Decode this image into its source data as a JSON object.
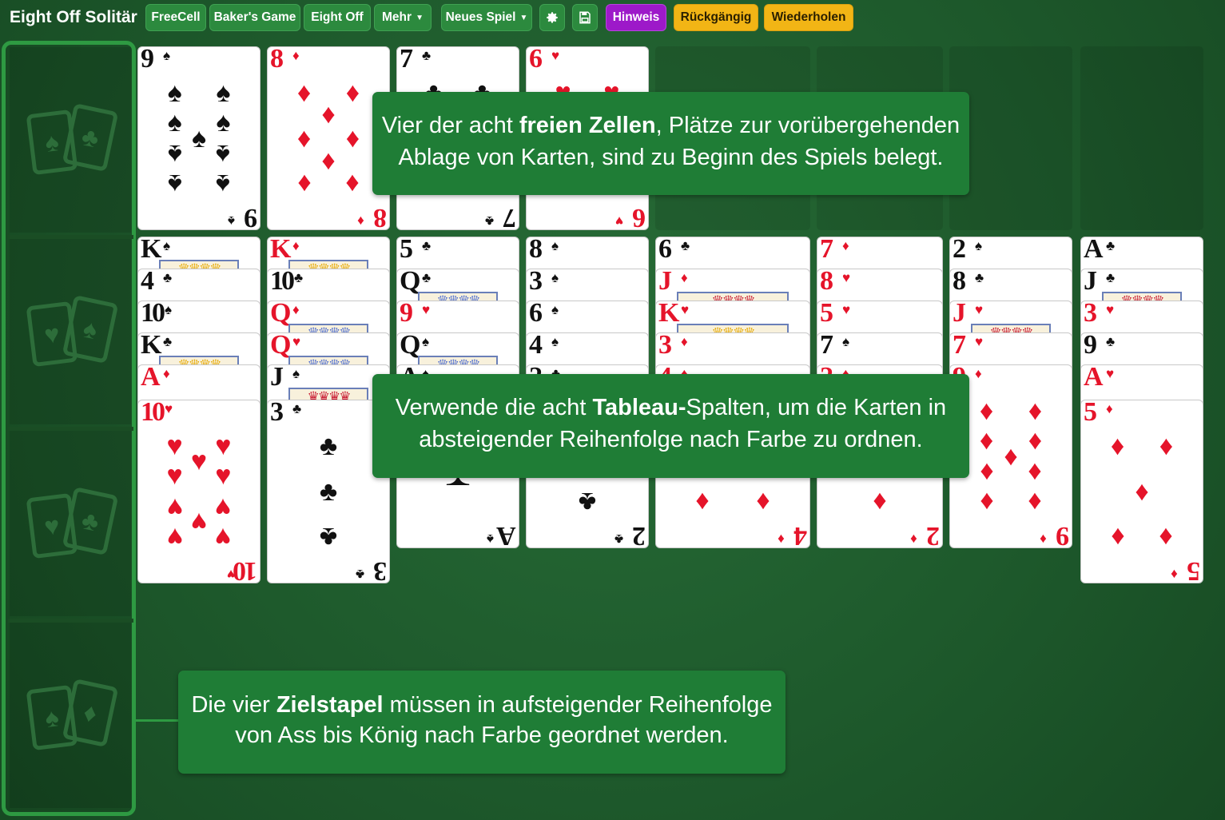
{
  "app": {
    "title": "Eight Off Solitär"
  },
  "toolbar": {
    "freecell": "FreeCell",
    "bakers_game": "Baker's Game",
    "eight_off": "Eight Off",
    "more": "Mehr",
    "new_game": "Neues Spiel",
    "hint": "Hinweis",
    "undo": "Rückgängig",
    "redo": "Wiederholen"
  },
  "icons": {
    "settings": "gear-icon",
    "save": "floppy-disk-icon",
    "dropdown": "chevron-down-icon"
  },
  "colors": {
    "felt": "#1e5a2c",
    "toolbar_green": "#2c8a3e",
    "hint_purple": "#9d19c9",
    "undo_yellow": "#f2b515",
    "red_suit": "#e5142a"
  },
  "free_cells": [
    {
      "rank": "9",
      "suit": "♠"
    },
    {
      "rank": "8",
      "suit": "♦"
    },
    {
      "rank": "7",
      "suit": "♣"
    },
    {
      "rank": "6",
      "suit": "♥"
    },
    null,
    null,
    null,
    null
  ],
  "tableau": [
    [
      {
        "rank": "K",
        "suit": "♠"
      },
      {
        "rank": "4",
        "suit": "♣"
      },
      {
        "rank": "10",
        "suit": "♠"
      },
      {
        "rank": "K",
        "suit": "♣"
      },
      {
        "rank": "A",
        "suit": "♦"
      },
      {
        "rank": "10",
        "suit": "♥"
      }
    ],
    [
      {
        "rank": "K",
        "suit": "♦"
      },
      {
        "rank": "10",
        "suit": "♣"
      },
      {
        "rank": "Q",
        "suit": "♦"
      },
      {
        "rank": "Q",
        "suit": "♥"
      },
      {
        "rank": "J",
        "suit": "♠"
      },
      {
        "rank": "3",
        "suit": "♣"
      }
    ],
    [
      {
        "rank": "5",
        "suit": "♣"
      },
      {
        "rank": "Q",
        "suit": "♣"
      },
      {
        "rank": "9",
        "suit": "♥"
      },
      {
        "rank": "Q",
        "suit": "♠"
      },
      {
        "rank": "A",
        "suit": "♠"
      }
    ],
    [
      {
        "rank": "8",
        "suit": "♠"
      },
      {
        "rank": "3",
        "suit": "♠"
      },
      {
        "rank": "6",
        "suit": "♠"
      },
      {
        "rank": "4",
        "suit": "♠"
      },
      {
        "rank": "2",
        "suit": "♣"
      }
    ],
    [
      {
        "rank": "6",
        "suit": "♣"
      },
      {
        "rank": "J",
        "suit": "♦"
      },
      {
        "rank": "K",
        "suit": "♥"
      },
      {
        "rank": "3",
        "suit": "♦"
      },
      {
        "rank": "4",
        "suit": "♦"
      }
    ],
    [
      {
        "rank": "7",
        "suit": "♦"
      },
      {
        "rank": "8",
        "suit": "♥"
      },
      {
        "rank": "5",
        "suit": "♥"
      },
      {
        "rank": "7",
        "suit": "♠"
      },
      {
        "rank": "2",
        "suit": "♦"
      }
    ],
    [
      {
        "rank": "2",
        "suit": "♠"
      },
      {
        "rank": "8",
        "suit": "♣"
      },
      {
        "rank": "J",
        "suit": "♥"
      },
      {
        "rank": "7",
        "suit": "♥"
      },
      {
        "rank": "9",
        "suit": "♦"
      }
    ],
    [
      {
        "rank": "A",
        "suit": "♣"
      },
      {
        "rank": "J",
        "suit": "♣"
      },
      {
        "rank": "3",
        "suit": "♥"
      },
      {
        "rank": "9",
        "suit": "♣"
      },
      {
        "rank": "A",
        "suit": "♥"
      },
      {
        "rank": "5",
        "suit": "♦"
      }
    ]
  ],
  "tips": {
    "free_cells": {
      "pre": "Vier der acht ",
      "bold": "freien Zellen",
      "post": ", Plätze zur vorübergehenden Ablage von Karten, sind zu Beginn des Spiels belegt."
    },
    "tableau": {
      "pre": "Verwende die acht ",
      "bold": "Tableau-",
      "post": "Spalten, um die Karten in absteigender Reihenfolge nach Farbe zu ordnen."
    },
    "foundation": {
      "pre": "Die vier ",
      "bold": "Zielstapel",
      "post": " müssen in aufsteigender Reihenfolge von Ass bis König nach Farbe geordnet werden."
    }
  }
}
